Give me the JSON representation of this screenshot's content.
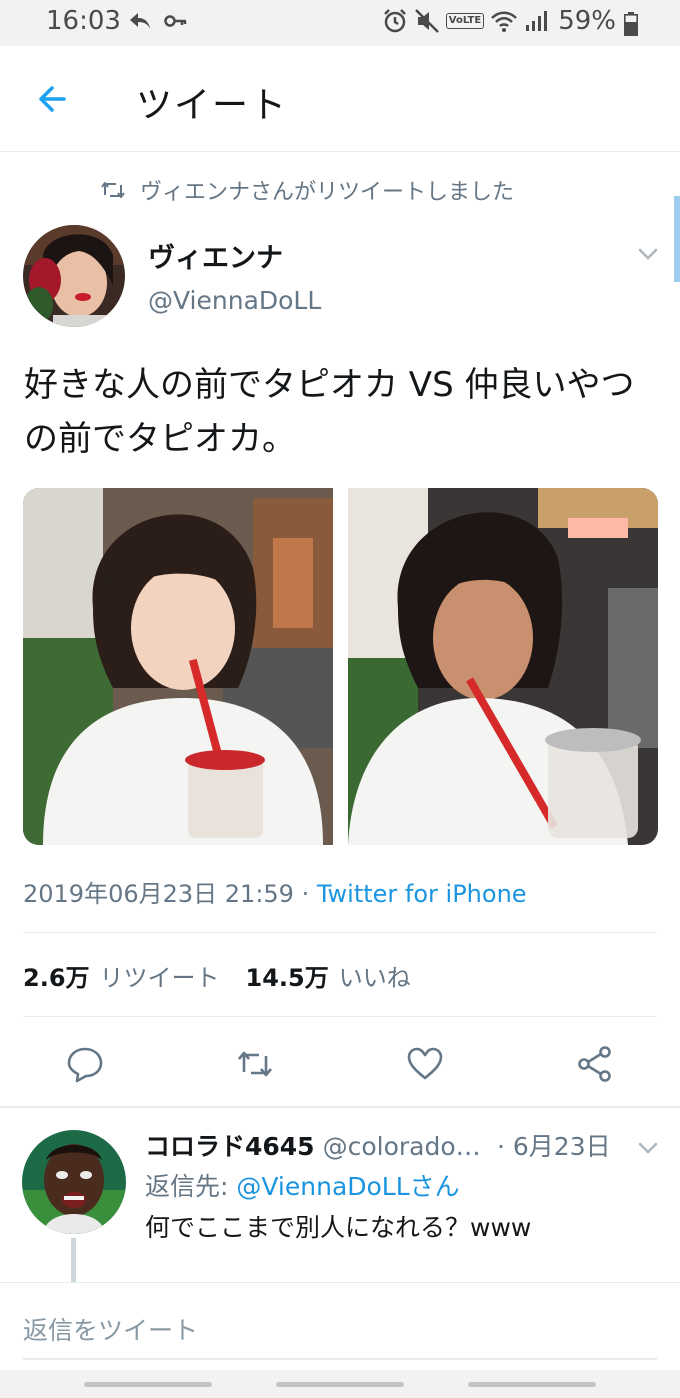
{
  "status_bar": {
    "time": "16:03",
    "volte": "VoLTE",
    "battery": "59%"
  },
  "header": {
    "title": "ツイート"
  },
  "retweet_banner": "ヴィエンナさんがリツイートしました",
  "tweet": {
    "author_name": "ヴィエンナ",
    "author_handle": "@ViennaDoLL",
    "text": "好きな人の前でタピオカ VS 仲良いやつの前でタピオカ。",
    "timestamp": "2019年06月23日 21:59 · ",
    "source": "Twitter for iPhone",
    "retweet_count": "2.6万",
    "retweet_label": "リツイート",
    "like_count": "14.5万",
    "like_label": "いいね"
  },
  "reply": {
    "name": "コロラド4645",
    "handle": "@colorado…",
    "date": "· 6月23日",
    "reply_to_prefix": "返信先: ",
    "reply_to_mention": "@ViennaDoLLさん",
    "text": "何でここまで別人になれる？www"
  },
  "composer": {
    "placeholder": "返信をツイート"
  },
  "colors": {
    "accent": "#1b95e0",
    "secondary_text": "#657786",
    "divider": "#e6ecf0"
  },
  "icons": [
    "back-arrow-icon",
    "retweet-icon",
    "chevron-down-icon",
    "reply-icon",
    "like-icon",
    "share-icon"
  ]
}
